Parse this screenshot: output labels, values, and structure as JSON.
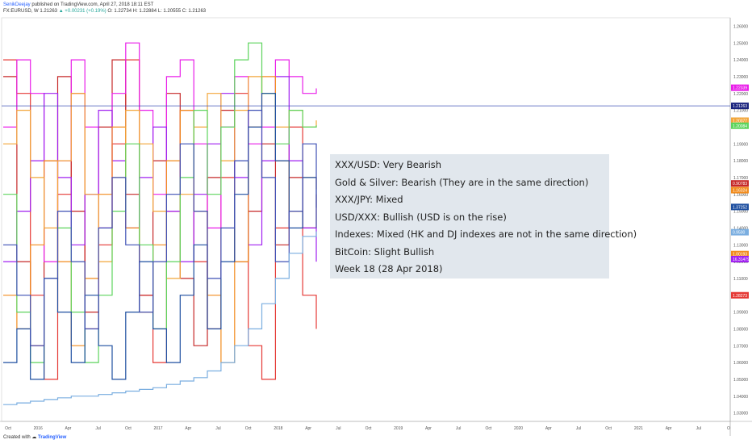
{
  "header": {
    "author": "SenikDeejay",
    "published": " published on TradingView.com, April 27, 2018 18:11 EST",
    "symbol_line": "FX:EURUSD, W  1.21263",
    "change": "▲ +0.00231 (+0.19%)",
    "ohlc": "O: 1.22734  H: 1.22884  L: 1.20555  C: 1.21263"
  },
  "footer": {
    "created_with": "Created with",
    "brand": "TradingView"
  },
  "annotation": {
    "lines": [
      "XXX/USD: Very Bearish",
      "Gold & Silver: Bearish  (They are in the same direction)",
      "XXX/JPY: Mixed",
      "USD/XXX: Bullish (USD is on the rise)",
      "Indexes: Mixed (HK and DJ indexes are not in the same direction)",
      "BitCoin: Slight Bullish",
      "Week 18 (28 Apr 2018)"
    ]
  },
  "chart_data": {
    "type": "line",
    "title": "",
    "symbol": "FX:EURUSD",
    "interval": "W",
    "y_ticks": [
      "1.26000",
      "1.25000",
      "1.24000",
      "1.23000",
      "1.22000",
      "1.21000",
      "1.20000",
      "1.19000",
      "1.18000",
      "1.17000",
      "1.16000",
      "1.15000",
      "1.14000",
      "1.13000",
      "1.12000",
      "1.11000",
      "1.10000",
      "1.09000",
      "1.08000",
      "1.07000",
      "1.06000",
      "1.05000",
      "1.04000",
      "1.03000"
    ],
    "ylim": [
      1.025,
      1.265
    ],
    "x_ticks": [
      "Oct",
      "2016",
      "Apr",
      "Jul",
      "Oct",
      "2017",
      "Apr",
      "Jul",
      "Oct",
      "2018",
      "Apr",
      "Jul",
      "Oct",
      "2019",
      "Apr",
      "Jul",
      "Oct",
      "2020",
      "Apr",
      "Jul",
      "Oct",
      "2021",
      "Apr",
      "Jul",
      "O"
    ],
    "current_price_line": 1.21263,
    "price_tags": [
      {
        "label": "1.22339",
        "value": 1.2234,
        "color": "#e91ee9"
      },
      {
        "label": "1.21263",
        "value": 1.2126,
        "color": "#1a237e"
      },
      {
        "label": "1.20377",
        "value": 1.2038,
        "color": "#f2a63a"
      },
      {
        "label": "1.20084",
        "value": 1.2008,
        "color": "#5dd45d"
      },
      {
        "label": "0.90783",
        "value": 1.1665,
        "color": "#c62828"
      },
      {
        "label": "1.16324",
        "value": 1.1625,
        "color": "#f28c1e"
      },
      {
        "label": "1.37252",
        "value": 1.1525,
        "color": "#1e4fa0"
      },
      {
        "label": "0.9500",
        "value": 1.1375,
        "color": "#7aaee0"
      },
      {
        "label": "1.00193",
        "value": 1.1245,
        "color": "#f28c1e"
      },
      {
        "label": "16.31479",
        "value": 1.1215,
        "color": "#a020f0"
      },
      {
        "label": "1.28273",
        "value": 1.1,
        "color": "#e53935"
      }
    ],
    "series": [
      {
        "color": "#e53935",
        "values": [
          1.24,
          1.22,
          1.1,
          1.05,
          1.16,
          1.22,
          1.08,
          1.13,
          1.19,
          1.24,
          1.1,
          1.06,
          1.15,
          1.21,
          1.12,
          1.08,
          1.17,
          1.22,
          1.07,
          1.05,
          1.14,
          1.2,
          1.1,
          1.08
        ]
      },
      {
        "color": "#c62828",
        "values": [
          1.23,
          1.12,
          1.07,
          1.18,
          1.23,
          1.15,
          1.09,
          1.2,
          1.24,
          1.16,
          1.1,
          1.18,
          1.22,
          1.11,
          1.07,
          1.17,
          1.21,
          1.12,
          1.15,
          1.19,
          1.13,
          1.17,
          1.14,
          1.16
        ]
      },
      {
        "color": "#e91ee9",
        "values": [
          1.2,
          1.24,
          1.22,
          1.12,
          1.18,
          1.24,
          1.2,
          1.14,
          1.22,
          1.25,
          1.21,
          1.16,
          1.23,
          1.24,
          1.19,
          1.14,
          1.2,
          1.23,
          1.19,
          1.2,
          1.24,
          1.23,
          1.22,
          1.223
        ]
      },
      {
        "color": "#a020f0",
        "values": [
          1.12,
          1.15,
          1.18,
          1.22,
          1.17,
          1.13,
          1.16,
          1.21,
          1.18,
          1.14,
          1.17,
          1.2,
          1.15,
          1.12,
          1.16,
          1.19,
          1.22,
          1.17,
          1.13,
          1.18,
          1.23,
          1.18,
          1.14,
          1.12
        ]
      },
      {
        "color": "#f28c1e",
        "values": [
          1.1,
          1.08,
          1.13,
          1.18,
          1.12,
          1.07,
          1.11,
          1.16,
          1.2,
          1.14,
          1.09,
          1.13,
          1.18,
          1.21,
          1.15,
          1.1,
          1.06,
          1.12,
          1.2,
          1.23,
          1.18,
          1.15,
          1.17,
          1.163
        ]
      },
      {
        "color": "#f2a63a",
        "values": [
          1.19,
          1.21,
          1.17,
          1.14,
          1.18,
          1.22,
          1.16,
          1.12,
          1.17,
          1.21,
          1.19,
          1.15,
          1.11,
          1.16,
          1.2,
          1.22,
          1.18,
          1.21,
          1.23,
          1.22,
          1.2,
          1.21,
          1.2,
          1.204
        ]
      },
      {
        "color": "#5dd45d",
        "values": [
          1.16,
          1.09,
          1.06,
          1.11,
          1.14,
          1.09,
          1.06,
          1.1,
          1.15,
          1.19,
          1.13,
          1.08,
          1.12,
          1.17,
          1.21,
          1.16,
          1.2,
          1.24,
          1.25,
          1.22,
          1.19,
          1.21,
          1.2,
          1.201
        ]
      },
      {
        "color": "#1e4fa0",
        "values": [
          1.06,
          1.08,
          1.05,
          1.11,
          1.09,
          1.06,
          1.1,
          1.07,
          1.05,
          1.09,
          1.12,
          1.08,
          1.06,
          1.1,
          1.13,
          1.08,
          1.12,
          1.16,
          1.2,
          1.22,
          1.18,
          1.14,
          1.17,
          1.152
        ]
      },
      {
        "color": "#3f51b5",
        "values": [
          1.13,
          1.1,
          1.07,
          1.11,
          1.15,
          1.12,
          1.08,
          1.14,
          1.17,
          1.13,
          1.09,
          1.12,
          1.16,
          1.19,
          1.15,
          1.11,
          1.14,
          1.18,
          1.21,
          1.17,
          1.12,
          1.15,
          1.19,
          1.14
        ]
      },
      {
        "color": "#7aaee0",
        "values": [
          1.035,
          1.036,
          1.037,
          1.038,
          1.039,
          1.04,
          1.04,
          1.041,
          1.042,
          1.043,
          1.044,
          1.045,
          1.047,
          1.049,
          1.051,
          1.055,
          1.06,
          1.07,
          1.08,
          1.095,
          1.11,
          1.125,
          1.135,
          1.138
        ]
      }
    ]
  }
}
